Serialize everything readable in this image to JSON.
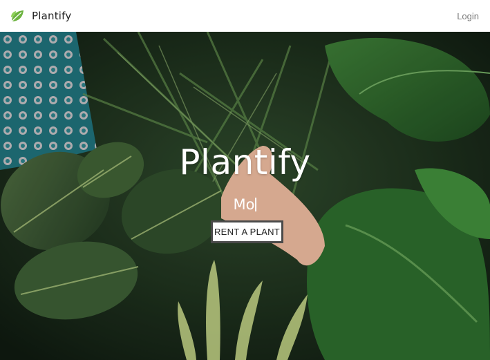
{
  "navbar": {
    "brand": "Plantify",
    "brand_icon": "leaf-icon",
    "login": "Login"
  },
  "hero": {
    "title": "Plantify",
    "typed_text": "Mo",
    "cta_label": "RENT A PLANT"
  },
  "colors": {
    "leaf_accent": "#6cb33f",
    "cta_border": "#4a4a4a",
    "nav_text": "#7a7a7a"
  }
}
